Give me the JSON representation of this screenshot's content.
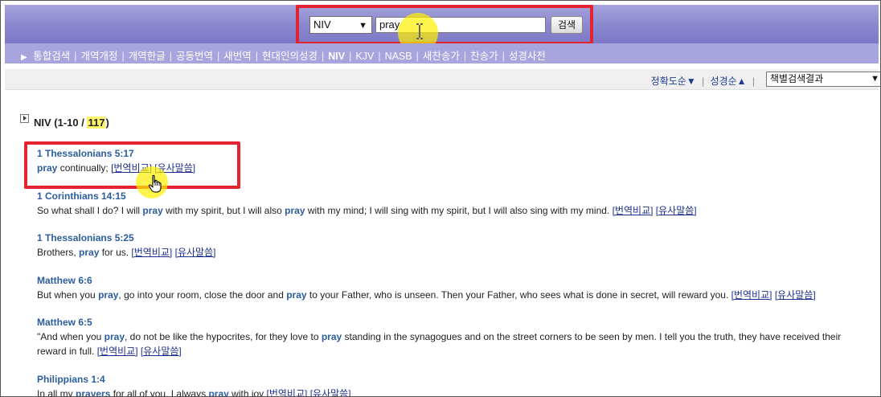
{
  "search": {
    "version_value": "NIV",
    "query_value": "pray",
    "button_label": "검색"
  },
  "nav": {
    "items": [
      {
        "label": "통합검색",
        "active": false
      },
      {
        "label": "개역개정",
        "active": false
      },
      {
        "label": "개역한글",
        "active": false
      },
      {
        "label": "공동번역",
        "active": false
      },
      {
        "label": "새번역",
        "active": false
      },
      {
        "label": "현대인의성경",
        "active": false
      },
      {
        "label": "NIV",
        "active": true
      },
      {
        "label": "KJV",
        "active": false
      },
      {
        "label": "NASB",
        "active": false
      },
      {
        "label": "새찬송가",
        "active": false
      },
      {
        "label": "찬송가",
        "active": false
      },
      {
        "label": "성경사전",
        "active": false
      }
    ]
  },
  "sort": {
    "accuracy_label": "정확도순▼",
    "canon_label": "성경순▲",
    "view_select_value": "책별검색결과"
  },
  "results": {
    "section_prefix": "NIV (1-10 / ",
    "total": "117",
    "section_suffix": ")",
    "link_compare": "[번역비교]",
    "link_similar": "[유사말씀]",
    "items": [
      {
        "reference": "1 Thessalonians 5:17",
        "segments": [
          {
            "t": "pray",
            "kw": true
          },
          {
            "t": " continually;",
            "kw": false
          }
        ]
      },
      {
        "reference": "1 Corinthians 14:15",
        "segments": [
          {
            "t": "So what shall I do? I will ",
            "kw": false
          },
          {
            "t": "pray",
            "kw": true
          },
          {
            "t": " with my spirit, but I will also ",
            "kw": false
          },
          {
            "t": "pray",
            "kw": true
          },
          {
            "t": " with my mind; I will sing with my spirit, but I will also sing with my mind.",
            "kw": false
          }
        ]
      },
      {
        "reference": "1 Thessalonians 5:25",
        "segments": [
          {
            "t": "Brothers, ",
            "kw": false
          },
          {
            "t": "pray",
            "kw": true
          },
          {
            "t": " for us.",
            "kw": false
          }
        ]
      },
      {
        "reference": "Matthew 6:6",
        "segments": [
          {
            "t": "But when you ",
            "kw": false
          },
          {
            "t": "pray",
            "kw": true
          },
          {
            "t": ", go into your room, close the door and ",
            "kw": false
          },
          {
            "t": "pray",
            "kw": true
          },
          {
            "t": " to your Father, who is unseen. Then your Father, who sees what is done in secret, will reward you.",
            "kw": false
          }
        ]
      },
      {
        "reference": "Matthew 6:5",
        "segments": [
          {
            "t": "\"And when you ",
            "kw": false
          },
          {
            "t": "pray",
            "kw": true
          },
          {
            "t": ", do not be like the hypocrites, for they love to ",
            "kw": false
          },
          {
            "t": "pray",
            "kw": true
          },
          {
            "t": " standing in the synagogues and on the street corners to be seen by men. I tell you the truth, they have received their reward in full.",
            "kw": false
          }
        ]
      },
      {
        "reference": "Philippians 1:4",
        "segments": [
          {
            "t": "In all my ",
            "kw": false
          },
          {
            "t": "prayers",
            "kw": true
          },
          {
            "t": " for all of you, I always ",
            "kw": false
          },
          {
            "t": "pray",
            "kw": true
          },
          {
            "t": " with joy",
            "kw": false
          }
        ]
      }
    ]
  },
  "colors": {
    "search_band": "#8a86cf",
    "nav_band": "#a7a4de",
    "highlight_border": "#e3232f",
    "keyword": "#2c5d9e",
    "cursor_halo": "#fff000"
  }
}
